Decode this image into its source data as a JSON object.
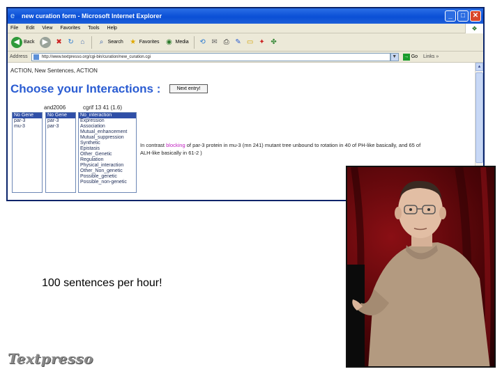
{
  "browser": {
    "title": "new curation form - Microsoft Internet Explorer",
    "controls": {
      "minimize": "_",
      "maximize": "□",
      "close": "✕"
    },
    "menu": [
      "File",
      "Edit",
      "View",
      "Favorites",
      "Tools",
      "Help"
    ],
    "toolbar": {
      "back": "Back",
      "search": "Search",
      "favorites": "Favorites",
      "media": "Media"
    },
    "address": {
      "label": "Address",
      "value": "http://www.textpresso.org/cgi-bin/curation/new_curation.cgi",
      "go": "Go",
      "links": "Links »"
    }
  },
  "page": {
    "action_line": "ACTION, New Sentences, ACTION",
    "heading": "Choose your Interactions :",
    "next_button": "Next entry!",
    "columns": [
      {
        "header": "and2006",
        "items": [
          "No Gene",
          "par-3",
          "mu-3"
        ],
        "selected": 0
      },
      {
        "header": "",
        "items": [
          "No Gene",
          "par-3",
          "par-3"
        ],
        "selected": 0
      },
      {
        "header": "cgrif 13 41 (1.6)",
        "items": [
          "No_interaction",
          "Expression",
          "Association",
          "Mutual_enhancement",
          "Mutual_suppression",
          "Synthetic",
          "Epistasis",
          "Other_Genetic",
          "Regulation",
          "Physical_interaction",
          "Other_Non_genetic",
          "Possible_genetic",
          "Possible_non-genetic"
        ],
        "selected": 0
      }
    ],
    "sentence_before": "In contrast ",
    "sentence_highlight": "blocking",
    "sentence_after": " of par-3 protein in mu-3 (mn 241) mutant tree unbound to rotation in 40 of PH-like basically, and 65 of ALH-like basically in 61-2 )"
  },
  "slide": {
    "caption": "100 sentences per hour!",
    "logo": "Textpresso"
  }
}
